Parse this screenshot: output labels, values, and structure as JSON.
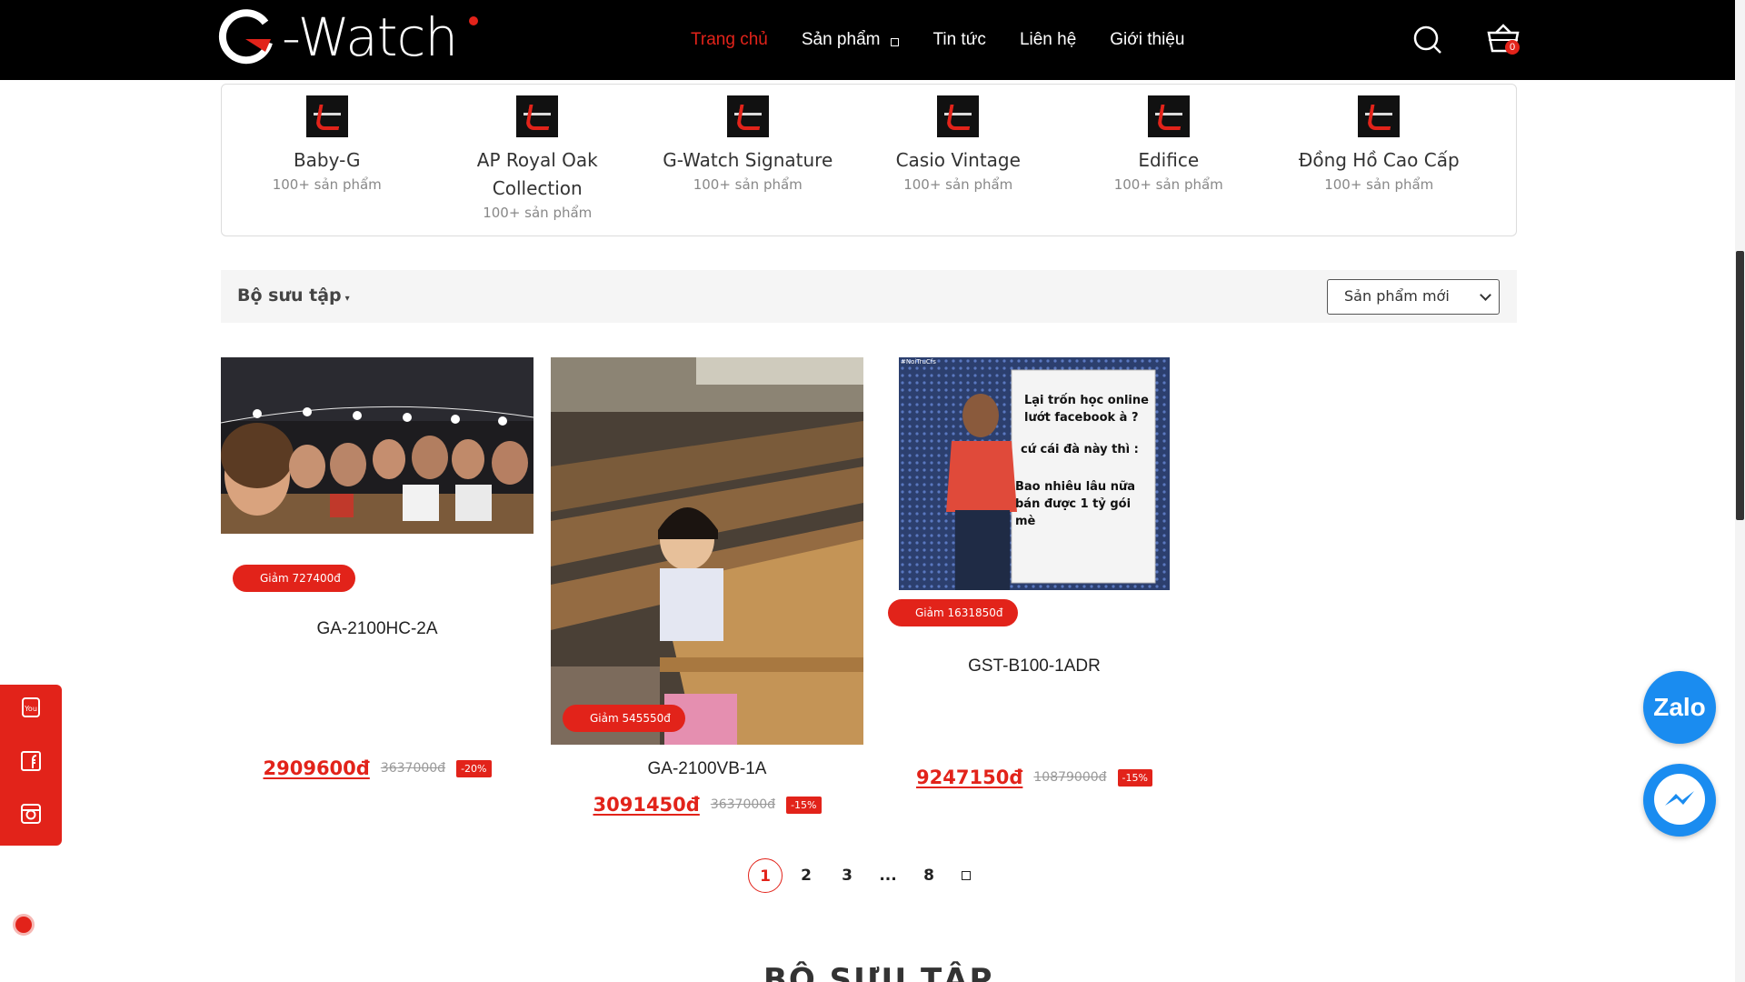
{
  "header": {
    "logo_text": "-Watch",
    "nav": [
      "Trang chủ",
      "Sản phẩm",
      "Tin tức",
      "Liên hệ",
      "Giới thiệu"
    ],
    "cart_count": "0",
    "active_color": "#e2231a"
  },
  "categories": [
    {
      "name": "Baby-G",
      "count": "100+ sản phẩm"
    },
    {
      "name": "AP Royal Oak Collection",
      "count": "100+ sản phẩm"
    },
    {
      "name": "G-Watch Signature",
      "count": "100+ sản phẩm"
    },
    {
      "name": "Casio Vintage",
      "count": "100+ sản phẩm"
    },
    {
      "name": "Edifice",
      "count": "100+ sản phẩm"
    },
    {
      "name": "Đồng Hồ Cao Cấp",
      "count": "100+ sản phẩm"
    }
  ],
  "collection_bar": {
    "title": "Bộ sưu tập",
    "sort_value": "Sản phẩm mới"
  },
  "products": [
    {
      "name": "GA-2100HC-2A",
      "badge": "Giảm 727400đ",
      "price": "2909600đ",
      "old_price": "3637000đ",
      "discount": "-20%"
    },
    {
      "name": "GA-2100VB-1A",
      "badge": "Giảm 545550đ",
      "price": "3091450đ",
      "old_price": "3637000đ",
      "discount": "-15%"
    },
    {
      "name": "GST-B100-1ADR",
      "badge": "Giảm 1631850đ",
      "price": "9247150đ",
      "old_price": "10879000đ",
      "discount": "-15%",
      "image_caption": {
        "tag": "#NoiTruCfs",
        "lines": [
          "Lại trốn học online",
          "lướt facebook à ?",
          "cứ cái đà này thì :",
          "Bao nhiêu lâu nữa",
          "bán được 1 tỷ gói mè"
        ]
      }
    }
  ],
  "pagination": [
    "1",
    "2",
    "3",
    "...",
    "8"
  ],
  "zalo_label": "Zalo",
  "section_title": "BỘ SƯU TẬP"
}
